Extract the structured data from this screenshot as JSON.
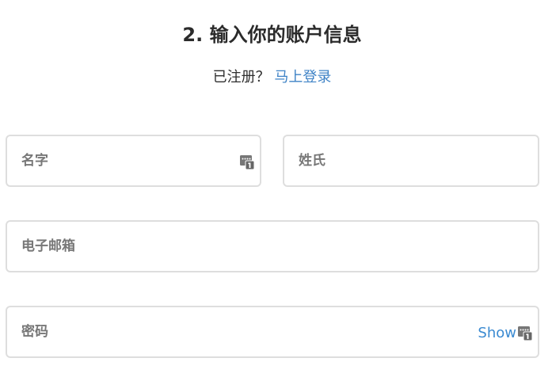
{
  "header": {
    "title": "2. 输入你的账户信息"
  },
  "login_prompt": {
    "text": "已注册？",
    "link_label": "马上登录"
  },
  "form": {
    "first_name": {
      "placeholder": "名字",
      "value": ""
    },
    "last_name": {
      "placeholder": "姓氏",
      "value": ""
    },
    "email": {
      "placeholder": "电子邮箱",
      "value": ""
    },
    "password": {
      "placeholder": "密码",
      "value": "",
      "toggle_label": "Show"
    }
  },
  "icons": {
    "password_manager": "password-manager-icon"
  },
  "colors": {
    "link": "#3f83c6",
    "show_toggle": "#3a8ad1",
    "field_border": "#dedede",
    "placeholder": "#777777",
    "heading": "#2b2b2b"
  }
}
